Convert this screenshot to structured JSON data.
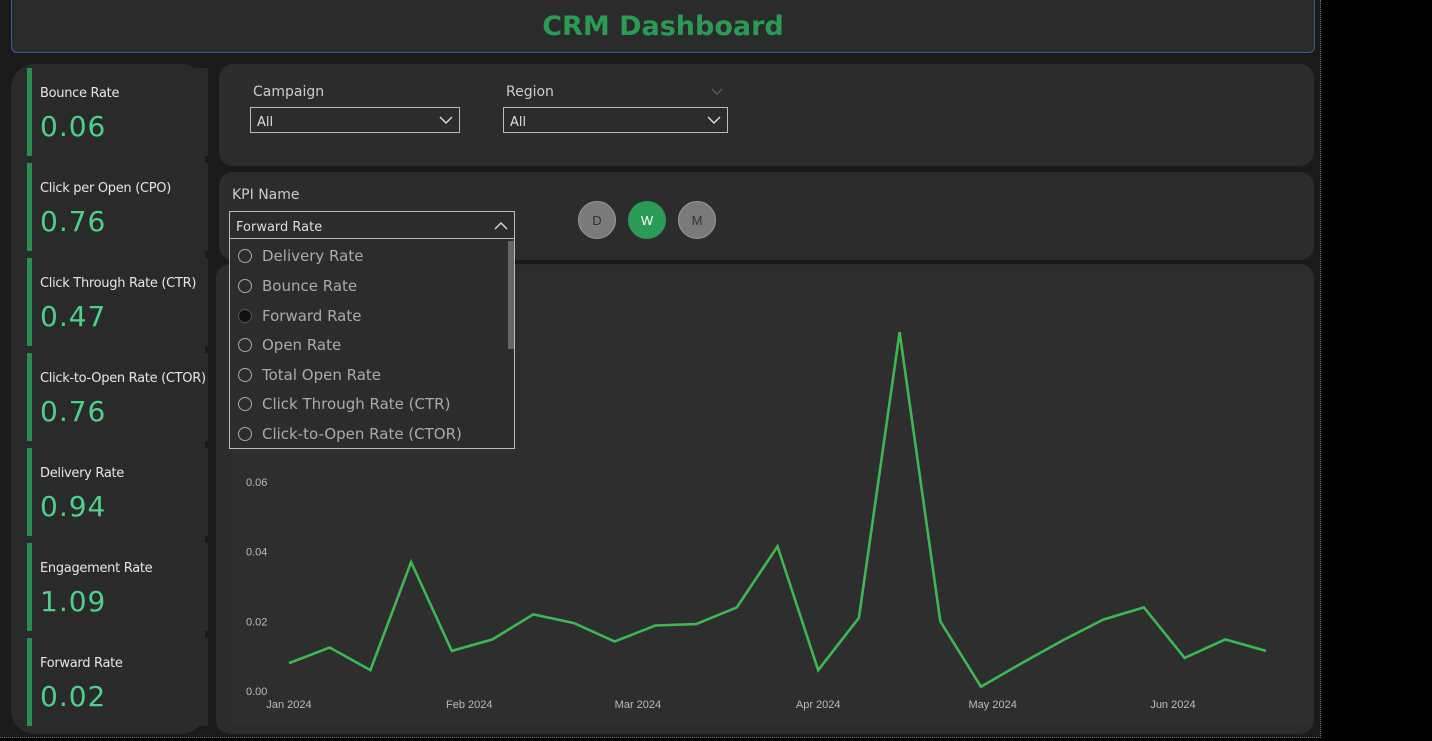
{
  "header": {
    "title": "CRM Dashboard"
  },
  "kpis": [
    {
      "label": "Bounce Rate",
      "value": "0.06"
    },
    {
      "label": "Click per Open (CPO)",
      "value": "0.76"
    },
    {
      "label": "Click Through Rate (CTR)",
      "value": "0.47"
    },
    {
      "label": "Click-to-Open Rate (CTOR)",
      "value": "0.76"
    },
    {
      "label": "Delivery Rate",
      "value": "0.94"
    },
    {
      "label": "Engagement Rate",
      "value": "1.09"
    },
    {
      "label": "Forward Rate",
      "value": "0.02"
    }
  ],
  "filters": {
    "campaign": {
      "label": "Campaign",
      "value": "All"
    },
    "region": {
      "label": "Region",
      "value": "All"
    }
  },
  "kpi_selector": {
    "label": "KPI Name",
    "value": "Forward Rate",
    "options": [
      {
        "label": "Delivery Rate",
        "selected": false
      },
      {
        "label": "Bounce Rate",
        "selected": false
      },
      {
        "label": "Forward Rate",
        "selected": true
      },
      {
        "label": "Open Rate",
        "selected": false
      },
      {
        "label": "Total Open Rate",
        "selected": false
      },
      {
        "label": "Click Through Rate (CTR)",
        "selected": false
      },
      {
        "label": "Click-to-Open Rate (CTOR)",
        "selected": false
      }
    ]
  },
  "granularity": {
    "options": [
      "D",
      "W",
      "M"
    ],
    "active": "W"
  },
  "colors": {
    "accent": "#2a9a55",
    "kpi_value": "#4fd08a",
    "line": "#3cb852"
  },
  "chart_data": {
    "type": "line",
    "y_ticks": [
      "0.00",
      "0.02",
      "0.04",
      "0.06"
    ],
    "x_ticks": [
      "Jan 2024",
      "Feb 2024",
      "Mar 2024",
      "Apr 2024",
      "May 2024",
      "Jun 2024"
    ],
    "ylim": [
      0,
      0.06
    ],
    "grid": false,
    "x": [
      "2024-01-01",
      "2024-01-08",
      "2024-01-15",
      "2024-01-22",
      "2024-01-29",
      "2024-02-05",
      "2024-02-12",
      "2024-02-19",
      "2024-02-26",
      "2024-03-04",
      "2024-03-11",
      "2024-03-18",
      "2024-03-25",
      "2024-04-01",
      "2024-04-08",
      "2024-04-15",
      "2024-04-22",
      "2024-04-29",
      "2024-05-06",
      "2024-05-13",
      "2024-05-20",
      "2024-05-27",
      "2024-06-03",
      "2024-06-10",
      "2024-06-17"
    ],
    "values": [
      0.008,
      0.0125,
      0.006,
      0.037,
      0.0115,
      0.0148,
      0.022,
      0.0195,
      0.0142,
      0.0188,
      0.0192,
      0.024,
      0.0415,
      0.006,
      0.021,
      0.103,
      0.02,
      0.0012,
      0.008,
      0.0145,
      0.0205,
      0.024,
      0.0095,
      0.0148,
      0.0115
    ]
  }
}
